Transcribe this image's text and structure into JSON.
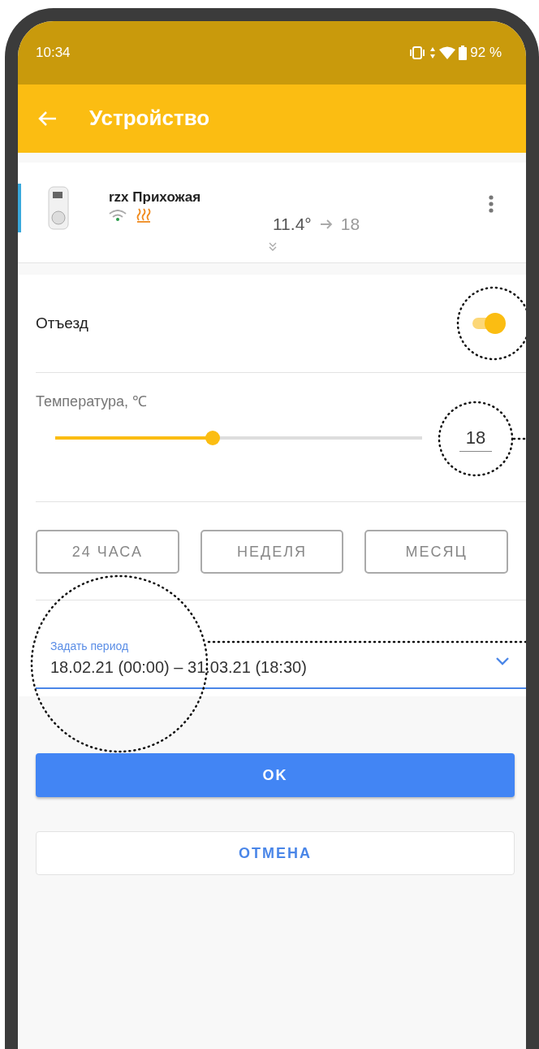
{
  "status_bar": {
    "time": "10:34",
    "battery": "92 %"
  },
  "app_bar": {
    "title": "Устройство"
  },
  "device": {
    "name": "rzx Прихожая",
    "current_temp": "11.4°",
    "target_temp": "18"
  },
  "away": {
    "label": "Отъезд",
    "on": true
  },
  "temperature": {
    "label": "Температура, ℃",
    "level": 0.43,
    "value": "18"
  },
  "periods": [
    {
      "label": "24 ЧАСА",
      "selected": false
    },
    {
      "label": "НЕДЕЛЯ",
      "selected": false
    },
    {
      "label": "МЕСЯЦ",
      "selected": false
    }
  ],
  "period_field": {
    "label": "Задать период",
    "value": "18.02.21 (00:00) – 31.03.21 (18:30)"
  },
  "buttons": [
    {
      "label": "OK",
      "kind": "primary"
    },
    {
      "label": "ОТМЕНА",
      "kind": "secondary"
    }
  ]
}
